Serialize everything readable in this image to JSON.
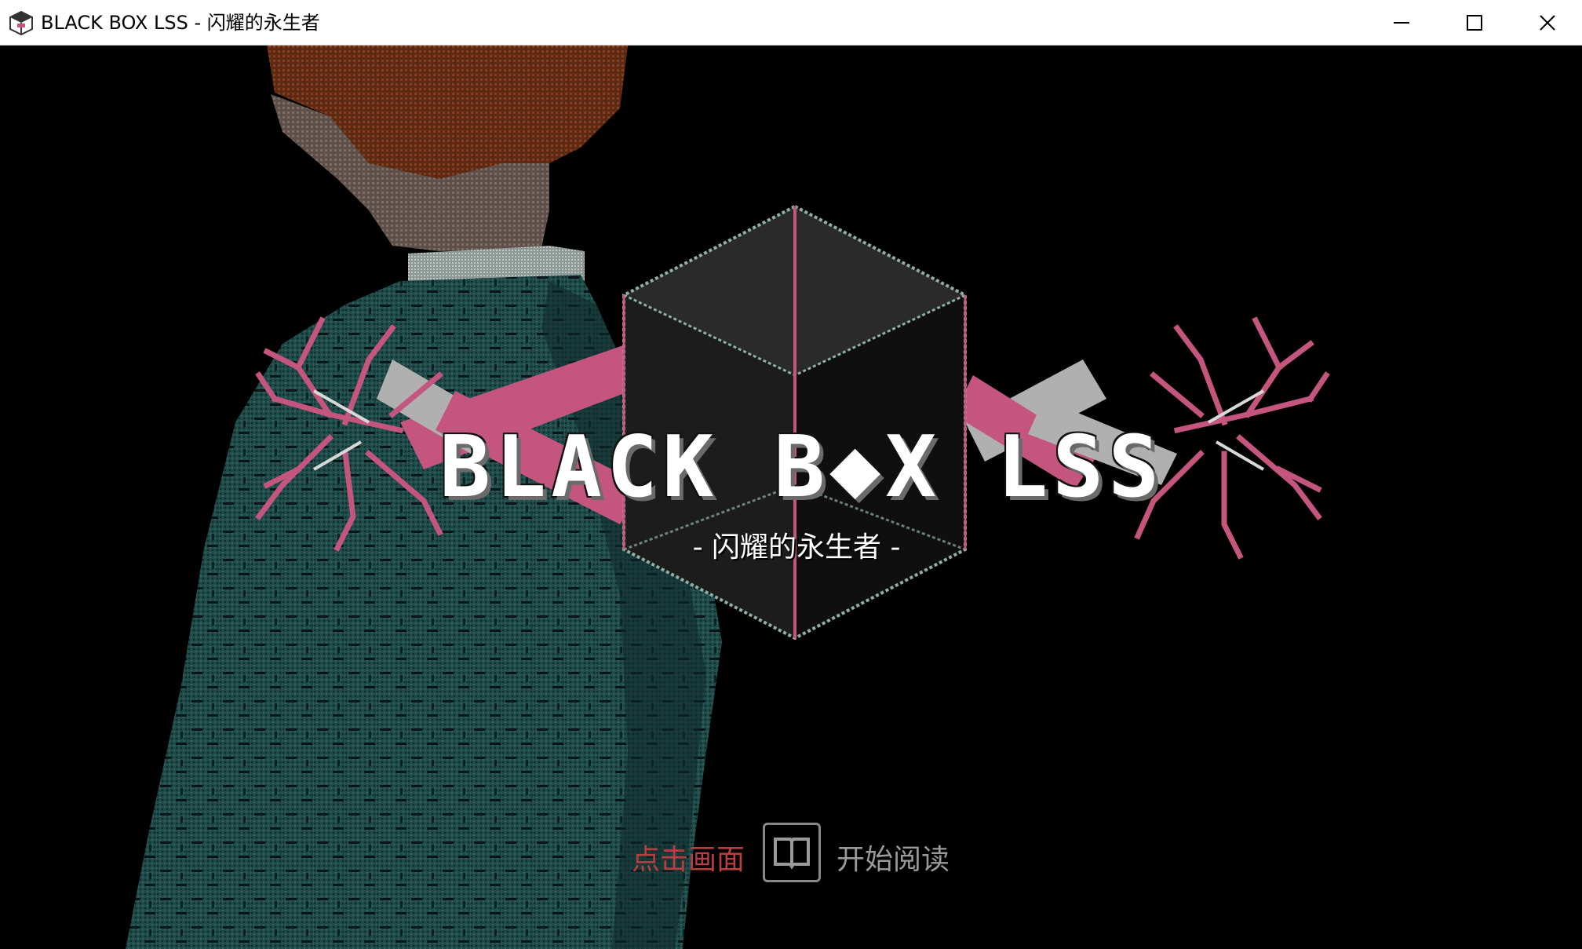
{
  "window": {
    "title": "BLACK BOX LSS - 闪耀的永生者",
    "icon": "game-cube-icon",
    "controls": [
      "minimize-icon",
      "maximize-icon",
      "close-icon"
    ]
  },
  "title_screen": {
    "logo_title": "BLACK B◆X LSS",
    "logo_subtitle": "- 闪耀的永生者 -",
    "prompt_tap": "点击画面",
    "prompt_icon": "book-icon",
    "prompt_start": "开始阅读"
  },
  "colors": {
    "accent_pink": "#c4557e",
    "cube_edge": "#8fb0a6",
    "jacket": "#1f4a48",
    "prompt_red": "#b83f3f",
    "prompt_gray": "#9a9a9a"
  }
}
